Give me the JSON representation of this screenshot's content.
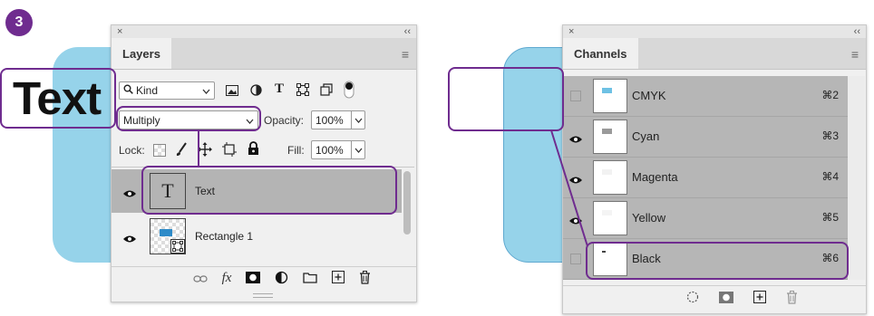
{
  "step": "3",
  "overlay": {
    "preview_text": "Text"
  },
  "layers_panel": {
    "close": "×",
    "collapse": "‹‹",
    "tab_label": "Layers",
    "menu": "≡",
    "filter": {
      "kind_label": "Kind",
      "icons": [
        "image-filter-icon",
        "adjustment-filter-icon",
        "type-filter-icon",
        "shape-filter-icon",
        "smart-object-filter-icon",
        "filter-toggle-icon"
      ]
    },
    "blend_mode": "Multiply",
    "opacity_label": "Opacity:",
    "opacity_value": "100%",
    "lock_label": "Lock:",
    "fill_label": "Fill:",
    "fill_value": "100%",
    "layers": [
      {
        "name": "Text",
        "thumb_glyph": "T",
        "selected": true
      },
      {
        "name": "Rectangle 1",
        "selected": false
      }
    ],
    "footer_icons": [
      "link-icon",
      "fx-icon",
      "mask-icon",
      "adjustment-icon",
      "folder-icon",
      "new-layer-icon",
      "trash-icon"
    ],
    "fx_label": "fx"
  },
  "channels_panel": {
    "close": "×",
    "collapse": "‹‹",
    "tab_label": "Channels",
    "menu": "≡",
    "channels": [
      {
        "name": "CMYK",
        "shortcut": "⌘2",
        "visible": false
      },
      {
        "name": "Cyan",
        "shortcut": "⌘3",
        "visible": true
      },
      {
        "name": "Magenta",
        "shortcut": "⌘4",
        "visible": true
      },
      {
        "name": "Yellow",
        "shortcut": "⌘5",
        "visible": true
      },
      {
        "name": "Black",
        "shortcut": "⌘6",
        "visible": false
      }
    ],
    "footer_icons": [
      "load-selection-icon",
      "save-selection-icon",
      "new-channel-icon",
      "delete-channel-icon"
    ]
  },
  "colors": {
    "accent": "#6f2c8f",
    "shape_fill": "#96d3ea",
    "selected_row": "#b4b4b4"
  }
}
